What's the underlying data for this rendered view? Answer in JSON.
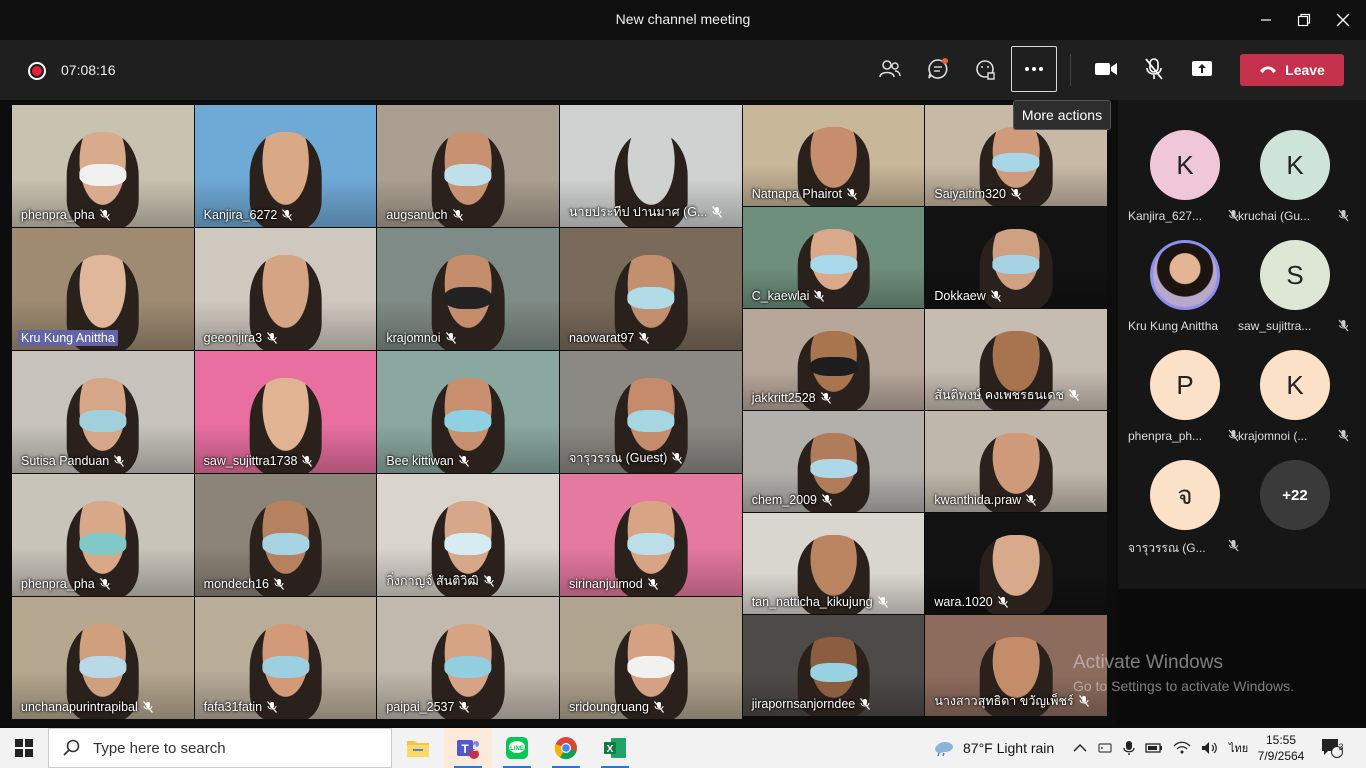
{
  "window": {
    "title": "New channel meeting"
  },
  "toolbar": {
    "timer": "07:08:16",
    "leave_label": "Leave",
    "tooltip": "More actions"
  },
  "tiles_columns": [
    [
      {
        "name": "phenpra_pha",
        "bg": "#c8c2b0",
        "skin": "#d8ab8c",
        "mask": "#f0f0f0"
      },
      {
        "name": "Kru Kung Anittha",
        "bg": "#9e8b72",
        "skin": "#e0b79a",
        "mask": "",
        "highlight": true
      },
      {
        "name": "Sutisa Panduan",
        "bg": "#c7c3bc",
        "skin": "#d5a687",
        "mask": "#9fd0dc"
      },
      {
        "name": "phenpra_pha",
        "bg": "#c8c4ba",
        "skin": "#d8a888",
        "mask": "#7fc9c8"
      },
      {
        "name": "unchanapurintrapibal",
        "bg": "#b6a890",
        "skin": "#cf9f7e",
        "mask": "#b9d9e6"
      }
    ],
    [
      {
        "name": "Kanjira_6272",
        "bg": "#6fa9d6",
        "skin": "#d9a885",
        "mask": ""
      },
      {
        "name": "geeonjira3",
        "bg": "#cfc8bf",
        "skin": "#d4a485",
        "mask": ""
      },
      {
        "name": "saw_sujittra1738",
        "bg": "#e86fa0",
        "skin": "#e0b393",
        "mask": ""
      },
      {
        "name": "mondech16",
        "bg": "#8b8478",
        "skin": "#b6815f",
        "mask": "#a8d3e3"
      },
      {
        "name": "fafa31fatin",
        "bg": "#b9ad9a",
        "skin": "#d29a78",
        "mask": "#9cd0e0"
      }
    ],
    [
      {
        "name": "augsanuch",
        "bg": "#aa9f90",
        "skin": "#c89272",
        "mask": "#bfe0ea"
      },
      {
        "name": "krajomnoi",
        "bg": "#7f8b86",
        "skin": "#c48d6b",
        "mask": "#222222"
      },
      {
        "name": "Bee kittiwan",
        "bg": "#8aa89f",
        "skin": "#c99070",
        "mask": "#8fd0e2"
      },
      {
        "name": "กิ่งกาญจ์ สันติวิฒิ",
        "bg": "#d9d4cc",
        "skin": "#d7a789",
        "mask": "#d7ecf2"
      },
      {
        "name": "paipai_2537",
        "bg": "#c1b9ad",
        "skin": "#d6a384",
        "mask": "#92cde0"
      }
    ],
    [
      {
        "name": "นายประทีป ปานมาศ (G...",
        "bg": "#d0d2d2",
        "skin": "#d0d2d2",
        "mask": ""
      },
      {
        "name": "naowarat97",
        "bg": "#7a6a5a",
        "skin": "#c28f6f",
        "mask": "#b2dbe8"
      },
      {
        "name": "จารุวรรณ (Guest)",
        "bg": "#8c8884",
        "skin": "#c48c6a",
        "mask": "#a6d6e2"
      },
      {
        "name": "sirinanjuimod",
        "bg": "#e6799f",
        "skin": "#d7a486",
        "mask": "#bcdee8"
      },
      {
        "name": "sridoungruang",
        "bg": "#b1a48f",
        "skin": "#d4a283",
        "mask": "#f1f1f1"
      }
    ],
    [
      {
        "name": "Natnapa Phairot",
        "bg": "#c9b799",
        "skin": "#c68e6c",
        "mask": ""
      },
      {
        "name": "C_kaewlai",
        "bg": "#6f8f7e",
        "skin": "#d8a98a",
        "mask": "#a9d8ea"
      },
      {
        "name": "jakkritt2528",
        "bg": "#b7a79a",
        "skin": "#a8754f",
        "mask": "#1d1d1d"
      },
      {
        "name": "chem_2009",
        "bg": "#b3b0ac",
        "skin": "#b07c5a",
        "mask": "#aed8e6"
      },
      {
        "name": "tan_natticha_kikujung",
        "bg": "#d9d5cf",
        "skin": "#b9845f",
        "mask": ""
      },
      {
        "name": "jirapornsanjorndee",
        "bg": "#4d4a48",
        "skin": "#8c5e40",
        "mask": "#98d2e2"
      }
    ],
    [
      {
        "name": "Saiyaitim320",
        "bg": "#c7b9a6",
        "skin": "#d09b7b",
        "mask": "#a7d6e7"
      },
      {
        "name": "Dokkaew",
        "bg": "#121212",
        "skin": "#cfa082",
        "mask": "#a5d3e3"
      },
      {
        "name": "สันติพงษ์ คงเพชรธนเดช",
        "bg": "#c6bdb2",
        "skin": "#a8744f",
        "mask": ""
      },
      {
        "name": "kwanthida.praw",
        "bg": "#bfb7ab",
        "skin": "#cf9a7a",
        "mask": ""
      },
      {
        "name": "wara.1020",
        "bg": "#121212",
        "skin": "#d8a98b",
        "mask": ""
      },
      {
        "name": "นางสาวสุทธิดา ขวัญเพ็ชร์",
        "bg": "#8d6c5e",
        "skin": "#c48c69",
        "mask": ""
      }
    ]
  ],
  "roster": [
    {
      "initial": "K",
      "name": "Kanjira_627...",
      "color": "#efc7d9"
    },
    {
      "initial": "K",
      "name": "kruchai (Gu...",
      "color": "#cfe4d8"
    },
    {
      "initial": "",
      "name": "Kru Kung Anittha",
      "color": "#b8a9c9",
      "photo": true
    },
    {
      "initial": "S",
      "name": "saw_sujittra...",
      "color": "#dde7d3"
    },
    {
      "initial": "P",
      "name": "phenpra_ph...",
      "color": "#fbe1c8"
    },
    {
      "initial": "K",
      "name": "krajomnoi (...",
      "color": "#fbe1c8"
    },
    {
      "initial": "จ",
      "name": "จารุวรรณ (G...",
      "color": "#fbe1c8"
    },
    {
      "initial": "+22",
      "name": "",
      "color": "#3a3a3a",
      "overflow": true
    }
  ],
  "watermark": {
    "line1": "Activate Windows",
    "line2": "Go to Settings to activate Windows."
  },
  "taskbar": {
    "search_placeholder": "Type here to search",
    "weather": "87°F  Light rain",
    "lang": "ไทย",
    "time": "15:55",
    "date": "7/9/2564",
    "teams_badge": "1",
    "notif_count": "3"
  }
}
